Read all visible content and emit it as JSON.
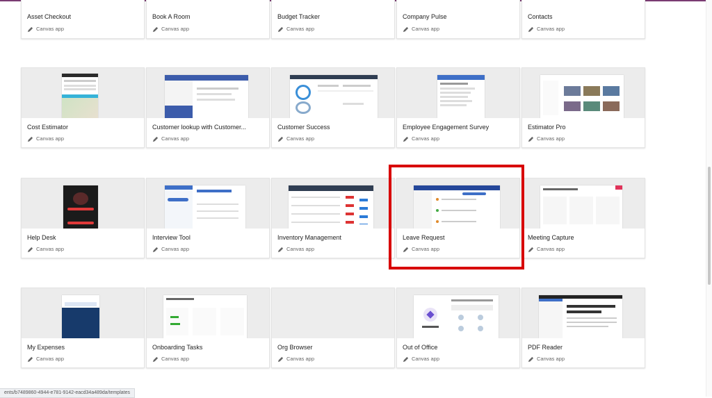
{
  "subtitle_label": "Canvas app",
  "cards": [
    {
      "title": "Asset Checkout"
    },
    {
      "title": "Book A Room"
    },
    {
      "title": "Budget Tracker"
    },
    {
      "title": "Company Pulse"
    },
    {
      "title": "Contacts"
    },
    {
      "title": "Cost Estimator"
    },
    {
      "title": "Customer lookup with Customer..."
    },
    {
      "title": "Customer Success"
    },
    {
      "title": "Employee Engagement Survey"
    },
    {
      "title": "Estimator Pro"
    },
    {
      "title": "Help Desk"
    },
    {
      "title": "Interview Tool"
    },
    {
      "title": "Inventory Management"
    },
    {
      "title": "Leave Request"
    },
    {
      "title": "Meeting Capture"
    },
    {
      "title": "My Expenses"
    },
    {
      "title": "Onboarding Tasks"
    },
    {
      "title": "Org Browser"
    },
    {
      "title": "Out of Office"
    },
    {
      "title": "PDF Reader"
    }
  ],
  "status_url": "ents/b7489860-4944-e781-9142-eacd34a489da/templates",
  "colors": {
    "highlight": "#d80000",
    "topline": "#7a3b72"
  }
}
